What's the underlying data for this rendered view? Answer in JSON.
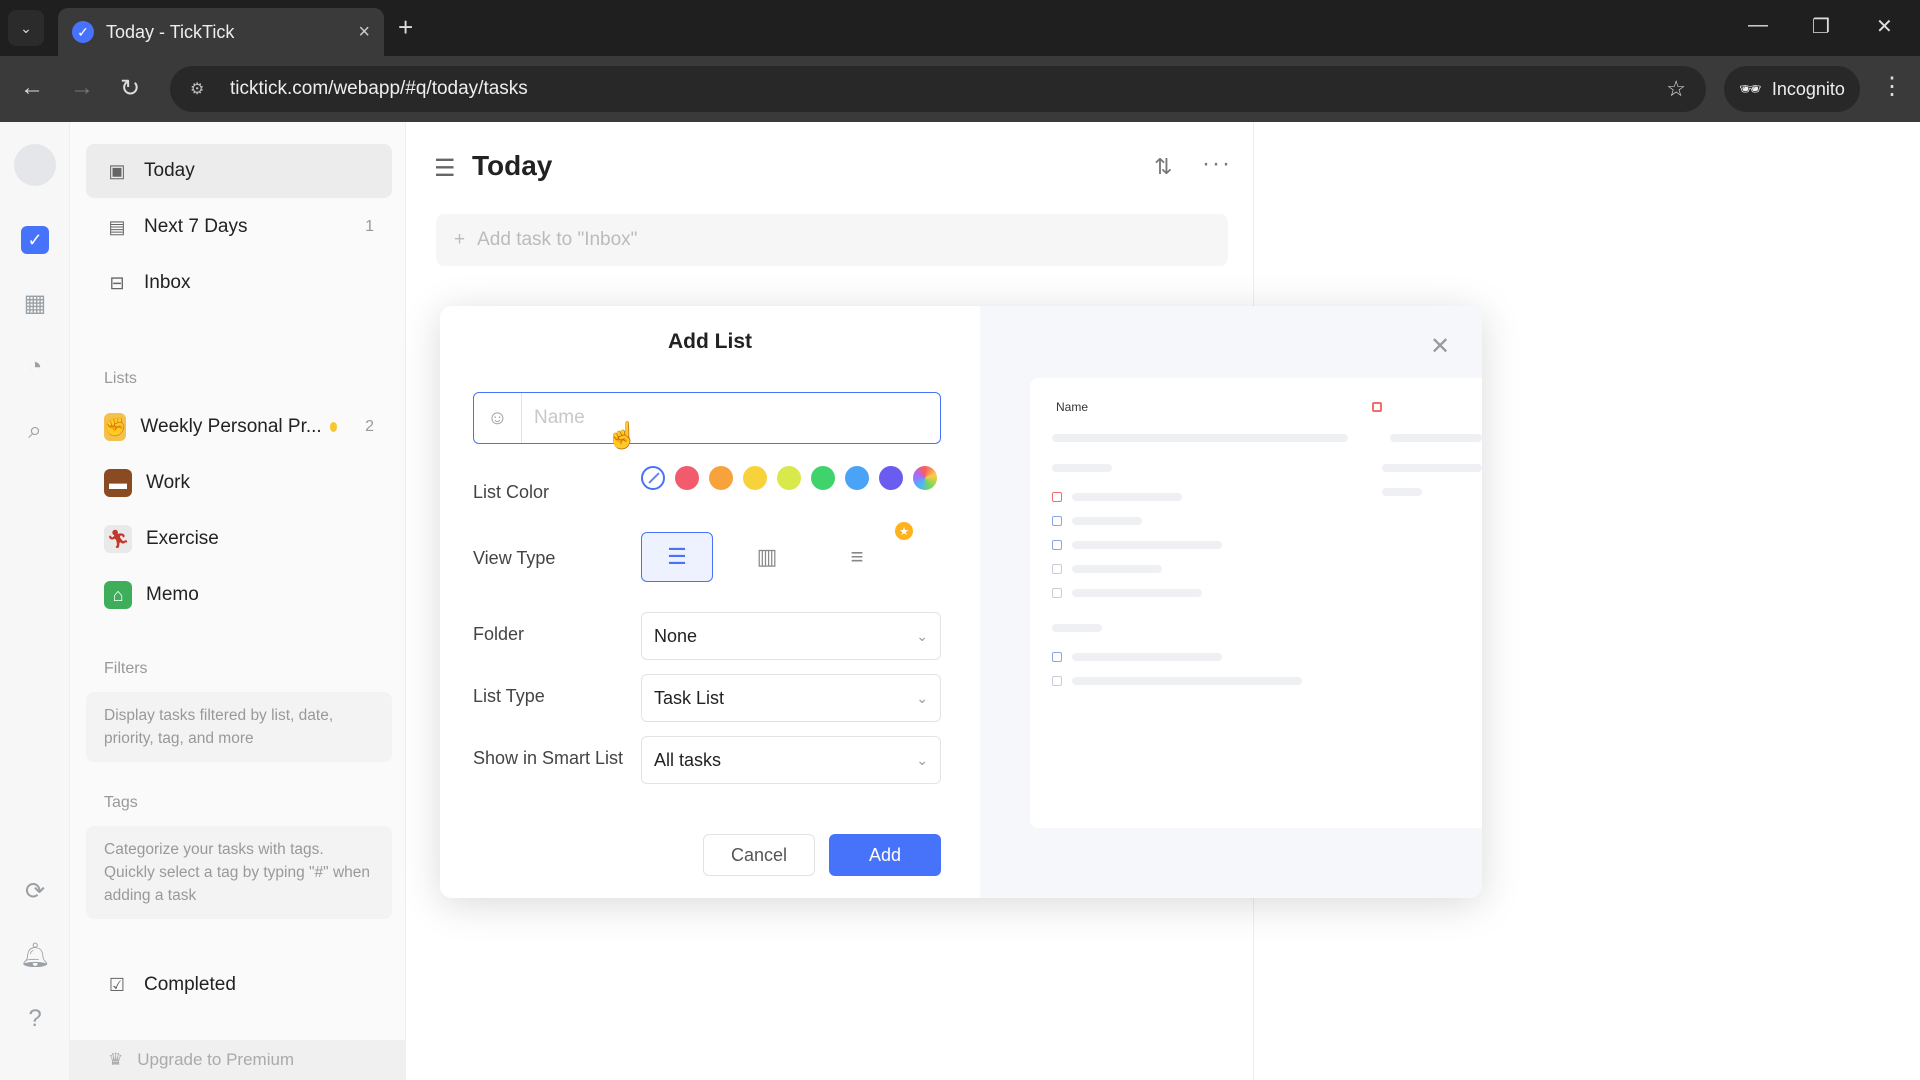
{
  "browser": {
    "tab_title": "Today - TickTick",
    "url": "ticktick.com/webapp/#q/today/tasks",
    "incognito_label": "Incognito"
  },
  "sidebar": {
    "smart_lists": [
      {
        "label": "Today",
        "count": ""
      },
      {
        "label": "Next 7 Days",
        "count": "1"
      },
      {
        "label": "Inbox",
        "count": ""
      }
    ],
    "lists_header": "Lists",
    "lists": [
      {
        "label": "Weekly Personal Pr...",
        "count": "2"
      },
      {
        "label": "Work",
        "count": ""
      },
      {
        "label": "Exercise",
        "count": ""
      },
      {
        "label": "Memo",
        "count": ""
      }
    ],
    "filters_header": "Filters",
    "filters_hint": "Display tasks filtered by list, date, priority, tag, and more",
    "tags_header": "Tags",
    "tags_hint": "Categorize your tasks with tags. Quickly select a tag by typing \"#\" when adding a task",
    "completed_label": "Completed",
    "upgrade_label": "Upgrade to Premium"
  },
  "main": {
    "title": "Today",
    "add_task_placeholder": "Add task to \"Inbox\""
  },
  "modal": {
    "title": "Add List",
    "name_placeholder": "Name",
    "list_color_label": "List Color",
    "colors": [
      "#f15b6c",
      "#f7a23b",
      "#f7d23b",
      "#d9e84a",
      "#3fd36b",
      "#4aa3f7",
      "#6b5cf0"
    ],
    "view_type_label": "View Type",
    "folder_label": "Folder",
    "folder_value": "None",
    "list_type_label": "List Type",
    "list_type_value": "Task List",
    "smart_list_label": "Show in Smart List",
    "smart_list_value": "All tasks",
    "cancel_label": "Cancel",
    "add_label": "Add",
    "preview_name": "Name"
  }
}
